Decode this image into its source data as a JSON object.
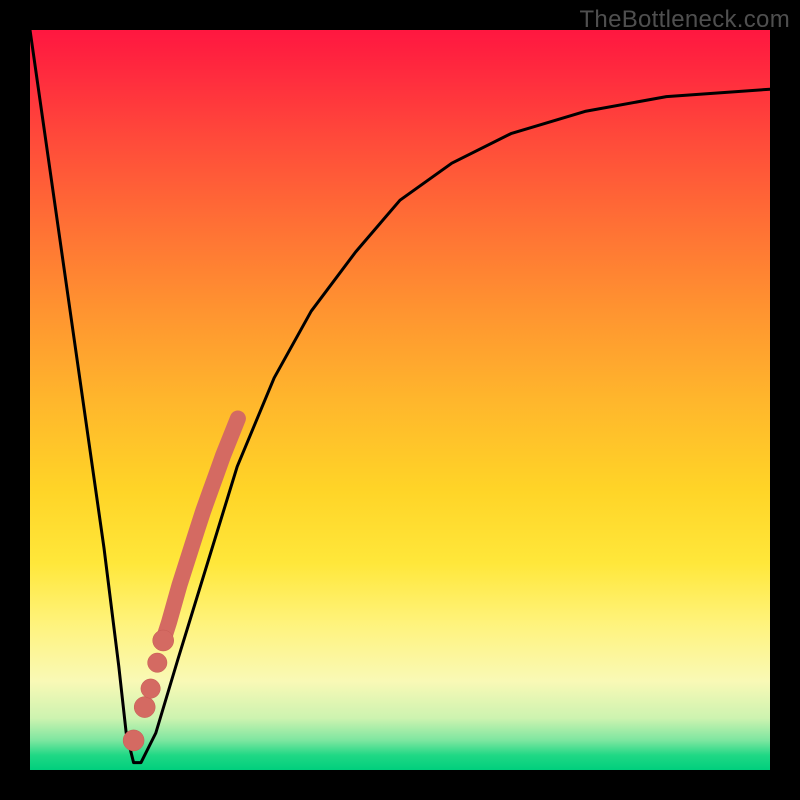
{
  "watermark": "TheBottleneck.com",
  "colors": {
    "frame": "#000000",
    "curve": "#000000",
    "marker_fill": "#d46a62",
    "marker_stroke": "#c65a53"
  },
  "chart_data": {
    "type": "line",
    "title": "",
    "xlabel": "",
    "ylabel": "",
    "xlim": [
      0,
      100
    ],
    "ylim": [
      0,
      100
    ],
    "grid": false,
    "legend": false,
    "series": [
      {
        "name": "bottleneck-curve",
        "x": [
          0,
          2,
          4,
          6,
          8,
          10,
          12,
          13,
          14,
          15,
          17,
          20,
          24,
          28,
          33,
          38,
          44,
          50,
          57,
          65,
          75,
          86,
          100
        ],
        "y": [
          100,
          86,
          72,
          58,
          44,
          30,
          14,
          5,
          1,
          1,
          5,
          15,
          28,
          41,
          53,
          62,
          70,
          77,
          82,
          86,
          89,
          91,
          92
        ]
      }
    ],
    "markers": [
      {
        "x": 14.0,
        "y": 4.0,
        "r": 1.6
      },
      {
        "x": 15.5,
        "y": 8.5,
        "r": 1.6
      },
      {
        "x": 16.3,
        "y": 11.0,
        "r": 1.4
      },
      {
        "x": 17.2,
        "y": 14.5,
        "r": 1.4
      },
      {
        "x": 18.0,
        "y": 17.5,
        "r": 1.6
      },
      {
        "x": 18.8,
        "y": 20.0,
        "r": 1.6
      },
      {
        "x": 19.5,
        "y": 22.5,
        "r": 1.5
      },
      {
        "x": 20.2,
        "y": 25.0,
        "r": 1.5
      },
      {
        "x": 21.0,
        "y": 27.5,
        "r": 1.5
      },
      {
        "x": 21.8,
        "y": 30.0,
        "r": 1.5
      },
      {
        "x": 22.6,
        "y": 32.5,
        "r": 1.5
      },
      {
        "x": 23.4,
        "y": 35.0,
        "r": 1.5
      },
      {
        "x": 24.3,
        "y": 37.5,
        "r": 1.5
      },
      {
        "x": 25.2,
        "y": 40.0,
        "r": 1.5
      },
      {
        "x": 26.1,
        "y": 42.5,
        "r": 1.5
      },
      {
        "x": 27.1,
        "y": 45.0,
        "r": 1.5
      },
      {
        "x": 28.1,
        "y": 47.5,
        "r": 1.5
      }
    ],
    "annotations": []
  }
}
